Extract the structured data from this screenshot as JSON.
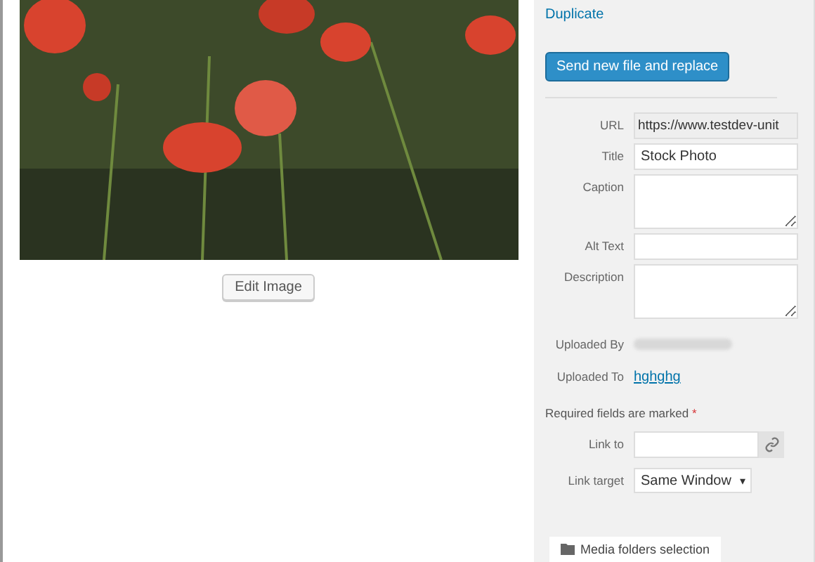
{
  "details": {
    "duplicate_link": "Duplicate",
    "replace_button": "Send new file and replace"
  },
  "fields": [
    {
      "label": "URL",
      "kind": "readonly",
      "value": "https://www.testdev-unit"
    },
    {
      "label": "Title",
      "kind": "text",
      "value": "Stock Photo"
    },
    {
      "label": "Caption",
      "kind": "textarea"
    },
    {
      "label": "Alt Text",
      "kind": "text"
    },
    {
      "label": "Description",
      "kind": "textarea"
    }
  ],
  "uploaded_by": {
    "label": "Uploaded By"
  },
  "uploaded_to": {
    "label": "Uploaded To",
    "link": "hghghg"
  },
  "required_note": {
    "text": "Required fields are marked",
    "marker": "*"
  },
  "link_to": {
    "label": "Link to"
  },
  "link_target": {
    "label": "Link target",
    "value": "Same Window",
    "caret": "▾"
  },
  "media_folders_button": "Media folders selection",
  "edit_image_button": "Edit Image"
}
